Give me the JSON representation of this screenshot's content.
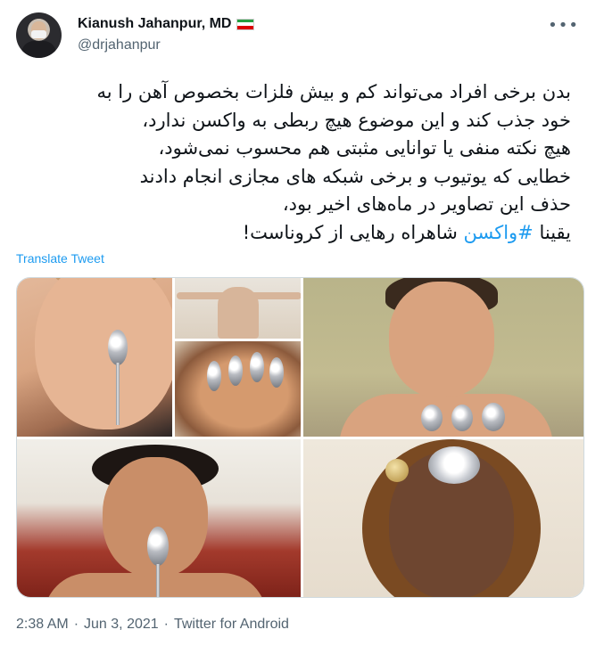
{
  "author": {
    "display_name": "Kianush Jahanpur, MD",
    "handle": "@drjahanpur",
    "flag_colors": [
      "#239f40",
      "#ffffff",
      "#da0000"
    ]
  },
  "menu": {
    "more_icon": "more-horizontal-icon",
    "more_label": "•••"
  },
  "tweet": {
    "lines": [
      "بدن برخی افراد می‌تواند کم و بیش فلزات بخصوص آهن را به",
      "خود جذب کند و این موضوع هیچ ربطی به واکسن ندارد،",
      "هیچ نکته منفی یا توانایی مثبتی هم محسوب نمی‌شود،",
      "خطایی که یوتیوب و برخی شبکه های مجازی انجام دادند",
      "حذف این تصاویر در ماه‌های اخیر بود،"
    ],
    "last_line_prefix": "یقینا ",
    "hashtag": "#واکسن",
    "last_line_suffix": " شاهراه رهایی از کروناست!",
    "hashtag_color": "#1d9bf0"
  },
  "translate_label": "Translate Tweet",
  "media": {
    "photo_count": 6
  },
  "meta": {
    "time": "2:38 AM",
    "separator": "·",
    "date": "Jun 3, 2021",
    "source": "Twitter for Android"
  }
}
